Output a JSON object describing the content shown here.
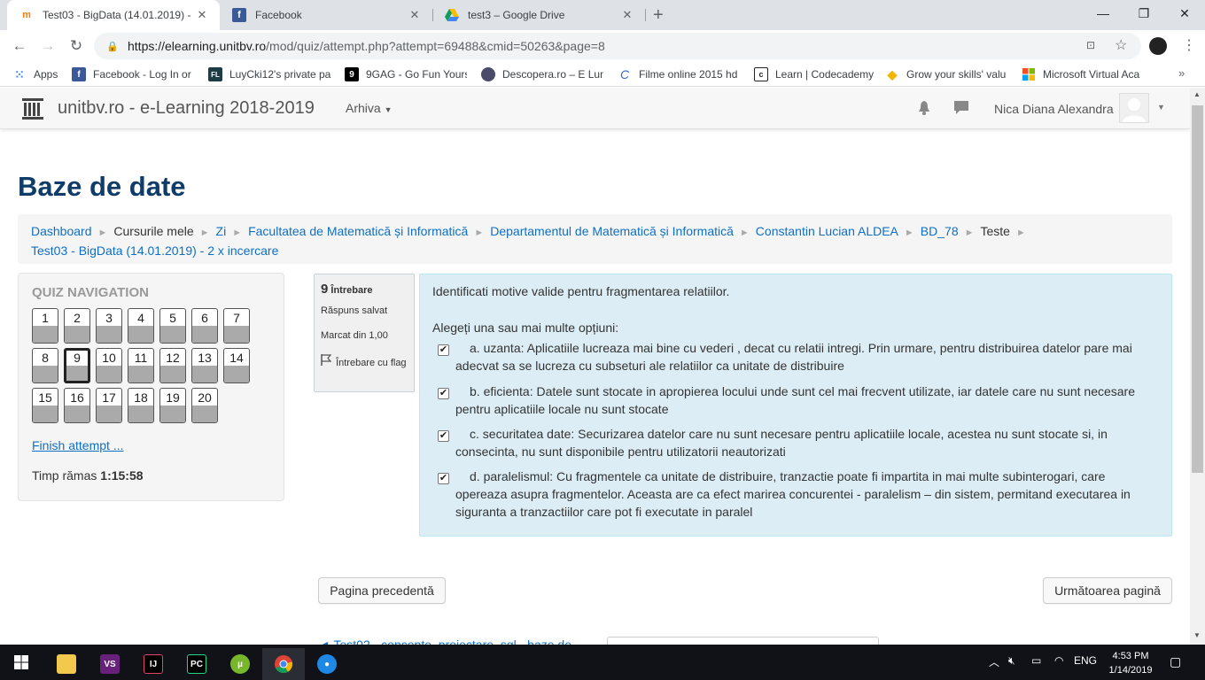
{
  "browser": {
    "tabs": [
      {
        "title": "Test03 - BigData (14.01.2019) - 2",
        "icon": "moodle-icon",
        "active": true
      },
      {
        "title": "Facebook",
        "icon": "facebook-icon",
        "active": false
      },
      {
        "title": "test3 – Google Drive",
        "icon": "google-drive-icon",
        "active": false
      }
    ],
    "url_host": "https://elearning.unitbv.ro",
    "url_path": "/mod/quiz/attempt.php?attempt=69488&cmid=50263&page=8",
    "bookmarks": [
      {
        "label": "Apps",
        "icon": "apps-grid-icon"
      },
      {
        "label": "Facebook - Log In or",
        "icon": "facebook-icon"
      },
      {
        "label": "LuyCki12's private pa",
        "icon": "fl-icon"
      },
      {
        "label": "9GAG - Go Fun Yours",
        "icon": "9gag-icon"
      },
      {
        "label": "Descopera.ro – E Lum",
        "icon": "globe-icon"
      },
      {
        "label": "Filme online 2015 hd",
        "icon": "c-icon"
      },
      {
        "label": "Learn | Codecademy",
        "icon": "codecademy-icon"
      },
      {
        "label": "Grow your skills' valu",
        "icon": "diamond-icon"
      },
      {
        "label": "Microsoft Virtual Aca",
        "icon": "microsoft-icon"
      }
    ]
  },
  "navbar": {
    "site_name": "unitbv.ro - e-Learning 2018-2019",
    "menu_label": "Arhiva",
    "user_name": "Nica Diana Alexandra"
  },
  "page": {
    "title": "Baze de date",
    "breadcrumb": [
      {
        "label": "Dashboard",
        "link": true
      },
      {
        "label": "Cursurile mele",
        "link": false
      },
      {
        "label": "Zi",
        "link": true
      },
      {
        "label": "Facultatea de Matematică și Informatică",
        "link": true
      },
      {
        "label": "Departamentul de Matematică și Informatică",
        "link": true
      },
      {
        "label": "Constantin Lucian ALDEA",
        "link": true
      },
      {
        "label": "BD_78",
        "link": true
      },
      {
        "label": "Teste",
        "link": false
      },
      {
        "label": "Test03 - BigData (14.01.2019) - 2 x incercare",
        "link": true
      }
    ]
  },
  "quiz_nav": {
    "title": "QUIZ NAVIGATION",
    "questions": [
      "1",
      "2",
      "3",
      "4",
      "5",
      "6",
      "7",
      "8",
      "9",
      "10",
      "11",
      "12",
      "13",
      "14",
      "15",
      "16",
      "17",
      "18",
      "19",
      "20"
    ],
    "current": "9",
    "finish_label": "Finish attempt ...",
    "timer_label": "Timp rămas",
    "timer_value": "1:15:58"
  },
  "question": {
    "number_label": "Întrebare",
    "number": "9",
    "state": "Răspuns salvat",
    "grade": "Marcat din 1,00",
    "flag_label": "Întrebare cu flag",
    "text": "Identificati motive valide pentru fragmentarea relatiilor.",
    "prompt": "Alegeți una sau mai multe opțiuni:",
    "options": [
      {
        "letter": "a.",
        "text": "uzanta: Aplicatiile lucreaza mai bine cu vederi , decat cu relatii intregi. Prin urmare, pentru distribuirea datelor pare mai adecvat sa se lucreza cu subseturi ale relatiilor ca unitate de distribuire",
        "checked": true
      },
      {
        "letter": "b.",
        "text": "eficienta: Datele sunt stocate in apropierea locului unde sunt cel mai frecvent utilizate, iar datele care nu sunt necesare pentru aplicatiile locale nu sunt stocate",
        "checked": true
      },
      {
        "letter": "c.",
        "text": "securitatea date: Securizarea datelor care nu sunt necesare pentru aplicatiile locale, acestea nu sunt stocate si, in consecinta, nu sunt disponibile pentru utilizatorii neautorizati",
        "checked": true
      },
      {
        "letter": "d.",
        "text": "paralelismul: Cu fragmentele ca unitate de distribuire, tranzactie poate fi  impartita in mai multe subinterogari, care opereaza asupra fragmentelor. Aceasta are ca efect marirea concurentei - paralelism – din sistem, permitand executarea in siguranta a tranzactiilor care pot fi executate in paralel",
        "checked": true
      }
    ]
  },
  "pagination": {
    "prev_label": "Pagina precedentă",
    "next_label": "Următoarea pagină"
  },
  "footer": {
    "partial_link": "◄ Test02 - concepte, proiectare, sql - baze de"
  },
  "taskbar": {
    "language": "ENG",
    "time": "4:53 PM",
    "date": "1/14/2019"
  }
}
